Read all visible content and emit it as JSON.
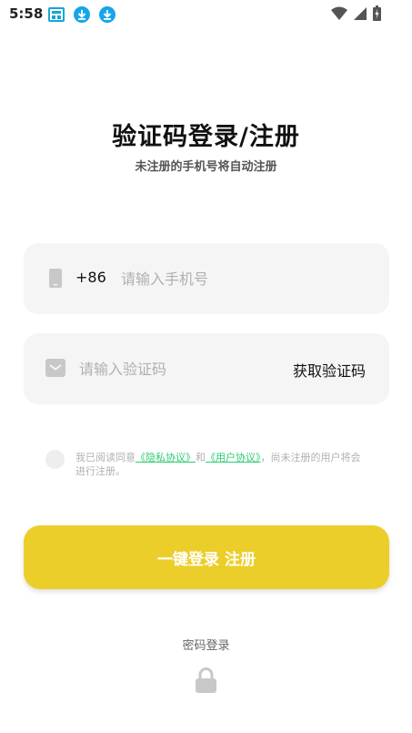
{
  "status_bar": {
    "time": "5:58",
    "left_icons": [
      "app-notification-icon",
      "download-icon",
      "download-icon"
    ],
    "right_icons": [
      "wifi-icon",
      "signal-icon",
      "battery-icon"
    ]
  },
  "header": {
    "title": "验证码登录/注册",
    "subtitle": "未注册的手机号将自动注册"
  },
  "phone_field": {
    "icon": "phone-icon",
    "country_code": "+86",
    "placeholder": "请输入手机号",
    "value": ""
  },
  "code_field": {
    "icon": "mail-icon",
    "placeholder": "请输入验证码",
    "value": "",
    "get_code_label": "获取验证码"
  },
  "agreement": {
    "checked": false,
    "text_prefix": "我已阅读同意",
    "privacy_link": "《隐私协议》",
    "and": "和",
    "user_link": "《用户协议》",
    "text_suffix": "，尚未注册的用户将会进行注册。"
  },
  "login_button": {
    "label": "一键登录 注册"
  },
  "password_login": {
    "label": "密码登录",
    "icon": "lock-icon"
  },
  "colors": {
    "accent": "#ECCE2A",
    "link": "#2ECC71",
    "field_bg": "#F5F5F5",
    "placeholder": "#B0B0B0"
  }
}
